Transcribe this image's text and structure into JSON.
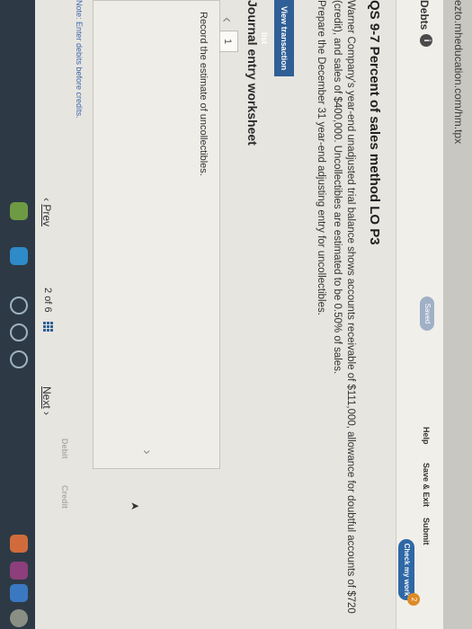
{
  "browser": {
    "url": "ezto.mheducation.com/hm.tpx"
  },
  "header": {
    "title": "Debts",
    "info_icon": "i",
    "saved_label": "Saved",
    "help_label": "Help",
    "save_exit_label": "Save & Exit",
    "submit_label": "Submit",
    "check_work_label": "Check my work",
    "check_count": "2"
  },
  "question": {
    "title": "QS 9-7 Percent of sales method LO P3",
    "body": "Warner Company's year-end unadjusted trial balance shows accounts receivable of $111,000, allowance for doubtful accounts of $720 (credit), and sales of $400,000. Uncollectibles are estimated to be 0.50% of sales.",
    "instruction": "Prepare the December 31 year-end adjusting entry for uncollectibles."
  },
  "buttons": {
    "view_transaction_list": "View transaction list"
  },
  "worksheet": {
    "title": "Journal entry worksheet",
    "prev_arrow": "‹",
    "tab_number": "1",
    "record_text": "Record the estimate of uncollectibles.",
    "next_arrow": "›",
    "note": "Note: Enter debits before credits.",
    "col_debit": "Debit",
    "col_credit": "Credit"
  },
  "pagination": {
    "prev_label": "Prev",
    "page_current": "2",
    "page_of": "of",
    "page_total": "6",
    "next_label": "Next"
  },
  "icons": {
    "prev_chevron": "‹",
    "next_chevron": "›",
    "cursor": "➤"
  },
  "colors": {
    "accent": "#2f5f96",
    "check_button": "#2f68a6",
    "badge": "#de8a25",
    "saved_pill": "#9fb0c7"
  }
}
